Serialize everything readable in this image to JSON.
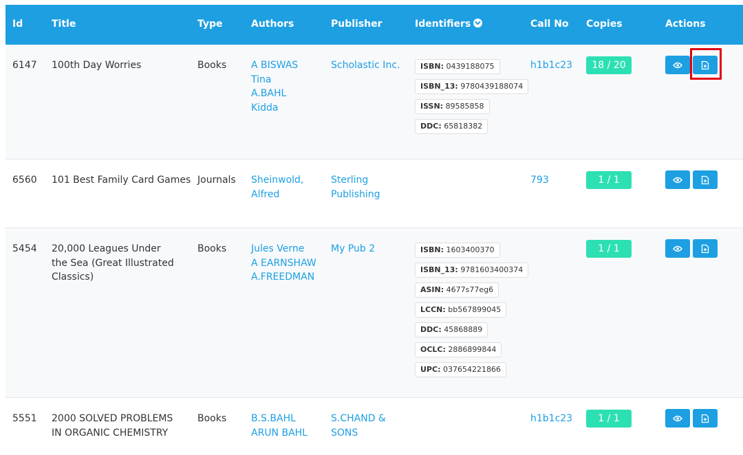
{
  "columns": {
    "id": "Id",
    "title": "Title",
    "type": "Type",
    "authors": "Authors",
    "publisher": "Publisher",
    "identifiers": "Identifiers",
    "call_no": "Call No",
    "copies": "Copies",
    "actions": "Actions"
  },
  "rows": [
    {
      "id": "6147",
      "title": "100th Day Worries",
      "type": "Books",
      "authors": [
        "A BISWAS",
        "Tina",
        "A.BAHL",
        "Kidda"
      ],
      "publisher": "Scholastic Inc.",
      "identifiers": [
        {
          "k": "ISBN:",
          "v": "0439188075"
        },
        {
          "k": "ISBN_13:",
          "v": "9780439188074"
        },
        {
          "k": "ISSN:",
          "v": "89585858"
        },
        {
          "k": "DDC:",
          "v": "65818382"
        }
      ],
      "call_no": "h1b1c23",
      "copies": "18 / 20"
    },
    {
      "id": "6560",
      "title": "101 Best Family Card Games",
      "type": "Journals",
      "authors": [
        "Sheinwold,",
        "Alfred"
      ],
      "publisher": "Sterling Publishing",
      "identifiers": [],
      "call_no": "793",
      "copies": "1 / 1"
    },
    {
      "id": "5454",
      "title": "20,000 Leagues Under the Sea (Great Illustrated Classics)",
      "type": "Books",
      "authors": [
        "Jules Verne",
        "A EARNSHAW",
        "A.FREEDMAN"
      ],
      "publisher": "My Pub 2",
      "identifiers": [
        {
          "k": "ISBN:",
          "v": "1603400370"
        },
        {
          "k": "ISBN_13:",
          "v": "9781603400374"
        },
        {
          "k": "ASIN:",
          "v": "4677s77eg6"
        },
        {
          "k": "LCCN:",
          "v": "bb567899045"
        },
        {
          "k": "DDC:",
          "v": "45868889"
        },
        {
          "k": "OCLC:",
          "v": "2886899844"
        },
        {
          "k": "UPC:",
          "v": "037654221866"
        }
      ],
      "call_no": "",
      "copies": "1 / 1"
    },
    {
      "id": "5551",
      "title": "2000 SOLVED PROBLEMS IN ORGANIC CHEMISTRY",
      "type": "Books",
      "authors": [
        "B.S.BAHL",
        "ARUN BAHL"
      ],
      "publisher": "S.CHAND & SONS",
      "identifiers": [],
      "call_no": "h1b1c23",
      "copies": "1 / 1"
    }
  ],
  "icons": {
    "view": "eye-icon",
    "export": "file-plus-icon",
    "identifiers_toggle": "chevron-down-circle-icon"
  },
  "colors": {
    "header": "#1d9fe2",
    "link": "#1d9fe2",
    "copies_badge": "#2de0b3",
    "highlight": "#e3000f"
  }
}
